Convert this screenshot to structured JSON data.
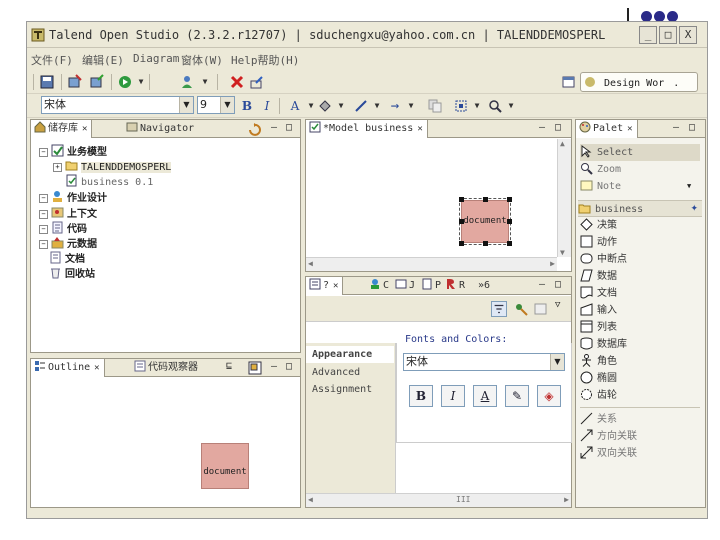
{
  "window": {
    "title": "Talend Open Studio (2.3.2.r12707) | sduchengxu@yahoo.com.cn | TALENDDEMOSPERL",
    "min": "_",
    "max": "□",
    "close": "X"
  },
  "menu": [
    "文件(F)",
    "编辑(E)",
    "Diagram",
    "窗体(W)",
    "Help帮助(H)"
  ],
  "perspective": {
    "label": "Design Wor"
  },
  "format": {
    "font": "宋体",
    "size": "9",
    "bold": "B",
    "italic": "I"
  },
  "repository": {
    "tab": "储存库",
    "tab2": "Navigator",
    "items": [
      {
        "label": "业务模型",
        "bold": true,
        "expander": "−"
      },
      {
        "label": "TALENDDEMOSPERL",
        "bold": false,
        "expander": "+"
      },
      {
        "label": "business 0.1",
        "bold": false,
        "expander": ""
      },
      {
        "label": "作业设计",
        "bold": true,
        "expander": "−"
      },
      {
        "label": "上下文",
        "bold": true,
        "expander": "−"
      },
      {
        "label": "代码",
        "bold": true,
        "expander": "−"
      },
      {
        "label": "元数据",
        "bold": true,
        "expander": "−"
      },
      {
        "label": "文档",
        "bold": true,
        "expander": ""
      },
      {
        "label": "回收站",
        "bold": true,
        "expander": ""
      }
    ]
  },
  "editor": {
    "tab": "*Model business",
    "shape_label": "document"
  },
  "outline": {
    "tab": "Outline",
    "tab2": "代码观察器",
    "shape_label": "document"
  },
  "properties": {
    "tabs": [
      "?",
      "C",
      "J",
      "P",
      "R",
      "»6"
    ],
    "sections": [
      "Appearance",
      "Advanced",
      "Assignment"
    ],
    "group_label": "Fonts and Colors:",
    "font_value": "宋体",
    "buttons": [
      "B",
      "I",
      "A",
      "✎",
      "◈"
    ]
  },
  "palette": {
    "tab": "Palet",
    "tools": [
      "Select",
      "Zoom",
      "Note"
    ],
    "drawer": "business",
    "shapes": [
      "决策",
      "动作",
      "中断点",
      "数据",
      "文档",
      "输入",
      "列表",
      "数据库",
      "角色",
      "椭圆",
      "齿轮"
    ],
    "connections": [
      "关系",
      "方向关联",
      "双向关联"
    ]
  },
  "colors": {
    "shape_fill": "#e2a8a0",
    "accent": "#2a2a88"
  },
  "scroll": {
    "h_grip": "III"
  }
}
